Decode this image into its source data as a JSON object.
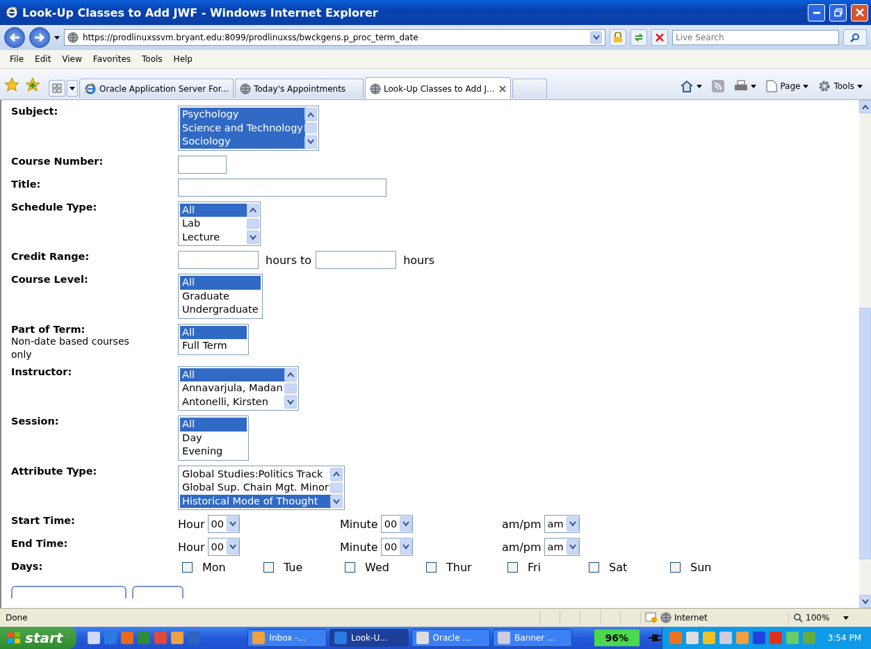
{
  "window": {
    "title": "Look-Up Classes to Add JWF - Windows Internet Explorer"
  },
  "address": {
    "url": "https://prodlinuxssvm.bryant.edu:8099/prodlinuxss/bwckgens.p_proc_term_date",
    "search_placeholder": "Live Search"
  },
  "menu": [
    "File",
    "Edit",
    "View",
    "Favorites",
    "Tools",
    "Help"
  ],
  "tabs": [
    {
      "label": "Oracle Application Server For...",
      "selected": false
    },
    {
      "label": "Today's Appointments",
      "selected": false
    },
    {
      "label": "Look-Up Classes to Add J...",
      "selected": true
    }
  ],
  "command_bar": [
    "Page",
    "Tools"
  ],
  "form": {
    "fields": [
      {
        "kind": "listbox",
        "label": "Subject:",
        "scrollable": true,
        "options": [
          {
            "label": "Psychology",
            "selected": true
          },
          {
            "label": "Science and Technology",
            "selected": true
          },
          {
            "label": "Sociology",
            "selected": true
          }
        ]
      },
      {
        "kind": "text",
        "label": "Course Number:",
        "wide": false
      },
      {
        "kind": "text",
        "label": "Title:",
        "wide": true
      },
      {
        "kind": "listbox",
        "label": "Schedule Type:",
        "scrollable": true,
        "options": [
          {
            "label": "All",
            "selected": true
          },
          {
            "label": "Lab",
            "selected": false
          },
          {
            "label": "Lecture",
            "selected": false
          }
        ]
      },
      {
        "kind": "range",
        "label": "Credit Range:",
        "middle": "hours to",
        "unit": "hours"
      },
      {
        "kind": "listbox",
        "label": "Course Level:",
        "scrollable": false,
        "options": [
          {
            "label": "All",
            "selected": true
          },
          {
            "label": "Graduate",
            "selected": false
          },
          {
            "label": "Undergraduate",
            "selected": false
          }
        ]
      },
      {
        "kind": "listbox",
        "label": "Part of Term:",
        "note": "Non-date based courses only",
        "scrollable": false,
        "options": [
          {
            "label": "All",
            "selected": true
          },
          {
            "label": "Full Term",
            "selected": false
          }
        ]
      },
      {
        "kind": "listbox",
        "label": "Instructor:",
        "scrollable": true,
        "options": [
          {
            "label": "All",
            "selected": true
          },
          {
            "label": "Annavarjula, Madan",
            "selected": false
          },
          {
            "label": "Antonelli, Kirsten",
            "selected": false
          }
        ]
      },
      {
        "kind": "listbox",
        "label": "Session:",
        "scrollable": false,
        "options": [
          {
            "label": "All",
            "selected": true
          },
          {
            "label": "Day",
            "selected": false
          },
          {
            "label": "Evening",
            "selected": false
          }
        ]
      },
      {
        "kind": "listbox",
        "label": "Attribute Type:",
        "scrollable": true,
        "options": [
          {
            "label": "Global Studies:Politics Track",
            "selected": false
          },
          {
            "label": "Global Sup. Chain Mgt. Minor",
            "selected": false
          },
          {
            "label": "Historical Mode of Thought",
            "selected": true
          }
        ]
      },
      {
        "kind": "time",
        "label": "Start Time:",
        "parts": [
          {
            "label": "Hour",
            "value": "00"
          },
          {
            "label": "Minute",
            "value": "00"
          },
          {
            "label": "am/pm",
            "value": "am"
          }
        ]
      },
      {
        "kind": "time",
        "label": "End Time:",
        "parts": [
          {
            "label": "Hour",
            "value": "00"
          },
          {
            "label": "Minute",
            "value": "00"
          },
          {
            "label": "am/pm",
            "value": "am"
          }
        ]
      },
      {
        "kind": "days",
        "label": "Days:",
        "days": [
          {
            "label": "Mon",
            "checked": false
          },
          {
            "label": "Tue",
            "checked": false
          },
          {
            "label": "Wed",
            "checked": false
          },
          {
            "label": "Thur",
            "checked": false
          },
          {
            "label": "Fri",
            "checked": false
          },
          {
            "label": "Sat",
            "checked": false
          },
          {
            "label": "Sun",
            "checked": false
          }
        ]
      }
    ]
  },
  "status_bar": {
    "text": "Done",
    "zone": "Internet",
    "zoom": "100%"
  },
  "taskbar": {
    "start": "start",
    "tasks": [
      {
        "label": "Inbox -...",
        "selected": false
      },
      {
        "label": "Look-U...",
        "selected": true
      },
      {
        "label": "Oracle ...",
        "selected": false
      },
      {
        "label": "Banner ...",
        "selected": false
      }
    ],
    "battery": "96%",
    "clock": "3:54 PM"
  }
}
